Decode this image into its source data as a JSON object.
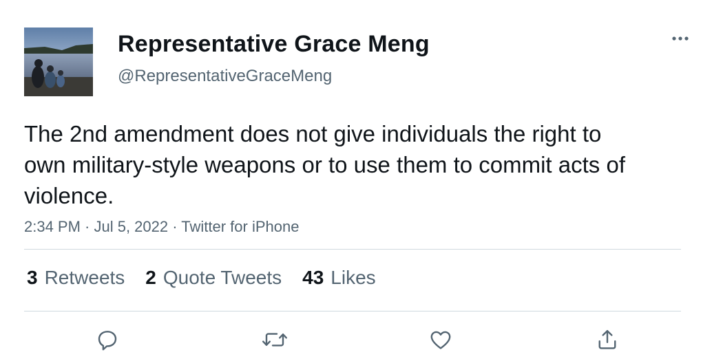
{
  "author": {
    "display_name": "Representative Grace Meng",
    "handle": "@RepresentativeGraceMeng",
    "avatar_icon": "profile-photo"
  },
  "tweet": {
    "text": "The 2nd amendment does not give individuals the right to own military-style weapons or to use them to commit acts of violence.",
    "meta": "2:34 PM · Jul 5, 2022 · Twitter for iPhone"
  },
  "stats": [
    {
      "count": "3",
      "label": "Retweets"
    },
    {
      "count": "2",
      "label": "Quote Tweets"
    },
    {
      "count": "43",
      "label": "Likes"
    }
  ],
  "actions": [
    {
      "icon": "reply-icon"
    },
    {
      "icon": "retweet-icon"
    },
    {
      "icon": "like-icon"
    },
    {
      "icon": "share-icon"
    }
  ],
  "colors": {
    "text_primary": "#0f1419",
    "text_secondary": "#536471",
    "divider": "#cfd9de",
    "background": "#ffffff"
  }
}
